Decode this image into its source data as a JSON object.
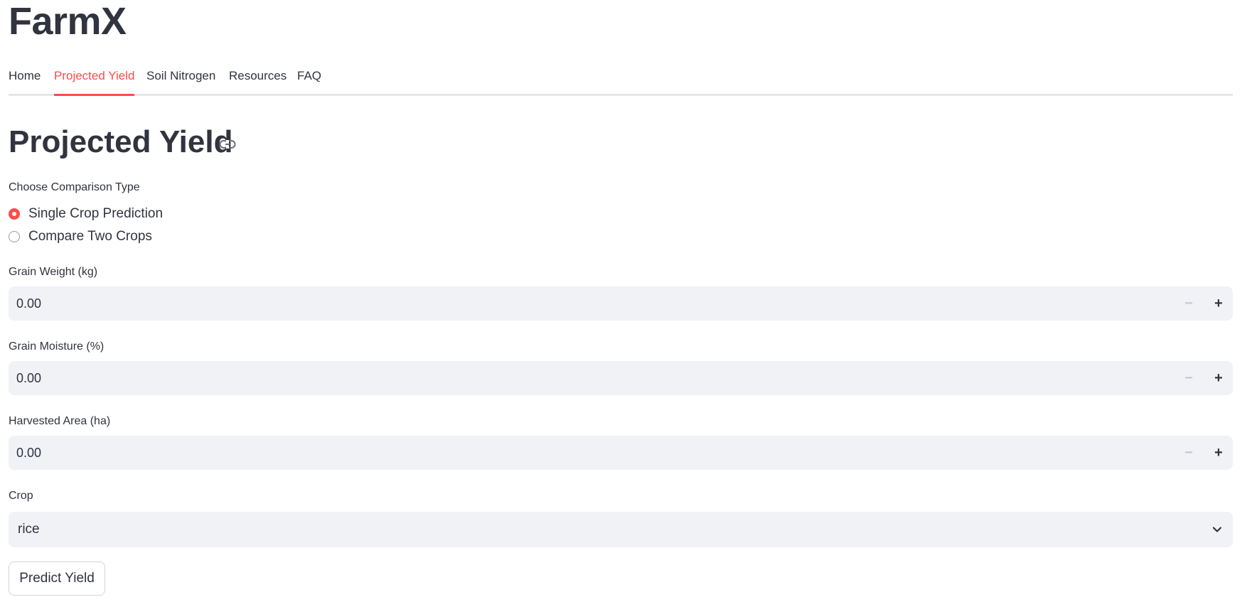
{
  "app": {
    "title": "FarmX"
  },
  "nav": {
    "tabs": [
      {
        "label": "Home",
        "active": false
      },
      {
        "label": "Projected Yield",
        "active": true
      },
      {
        "label": "Soil Nitrogen",
        "active": false
      },
      {
        "label": "Resources",
        "active": false
      },
      {
        "label": "FAQ",
        "active": false
      }
    ]
  },
  "page": {
    "title": "Projected Yield",
    "anchor_icon": "link-icon"
  },
  "comparison": {
    "label": "Choose Comparison Type",
    "options": [
      {
        "label": "Single Crop Prediction",
        "selected": true
      },
      {
        "label": "Compare Two Crops",
        "selected": false
      }
    ]
  },
  "fields": {
    "grain_weight": {
      "label": "Grain Weight (kg)",
      "value": "0.00"
    },
    "grain_moisture": {
      "label": "Grain Moisture (%)",
      "value": "0.00"
    },
    "harvested_area": {
      "label": "Harvested Area (ha)",
      "value": "0.00"
    }
  },
  "crop": {
    "label": "Crop",
    "selected": "rice"
  },
  "actions": {
    "predict_label": "Predict Yield"
  },
  "colors": {
    "accent": "#ff4b4b",
    "text": "#31333f",
    "input_bg": "#f0f2f6"
  }
}
